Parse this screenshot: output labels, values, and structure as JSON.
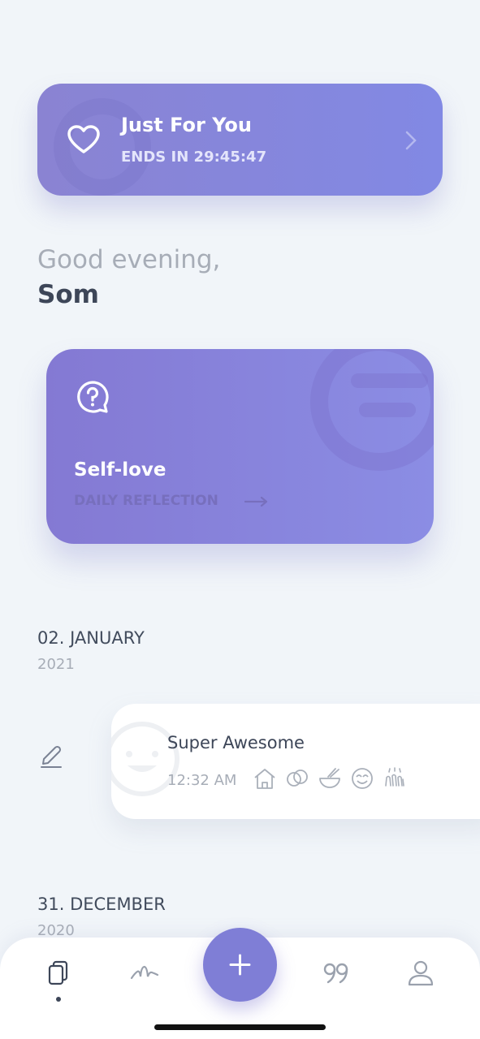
{
  "promo": {
    "title": "Just For You",
    "timer": "ENDS IN 29:45:47"
  },
  "greeting": {
    "salutation": "Good evening,",
    "name": "Som"
  },
  "reflection": {
    "title": "Self-love",
    "subtitle": "DAILY REFLECTION"
  },
  "entries": [
    {
      "date": "02. JANUARY",
      "year": "2021",
      "mood": "Super Awesome",
      "time": "12:32 AM",
      "activities": [
        "home-icon",
        "relationship-icon",
        "food-icon",
        "good-meal-icon",
        "clap-icon"
      ]
    },
    {
      "date": "31. DECEMBER",
      "year": "2020"
    }
  ],
  "tabbar": {
    "items": [
      "entries-icon",
      "stats-icon",
      "add-icon",
      "quotes-icon",
      "profile-icon"
    ],
    "active": "entries-icon"
  },
  "colors": {
    "accent": "#7f7ed6",
    "background": "#f1f5f9",
    "text_dark": "#3d4658",
    "text_muted": "#a7adb7"
  }
}
